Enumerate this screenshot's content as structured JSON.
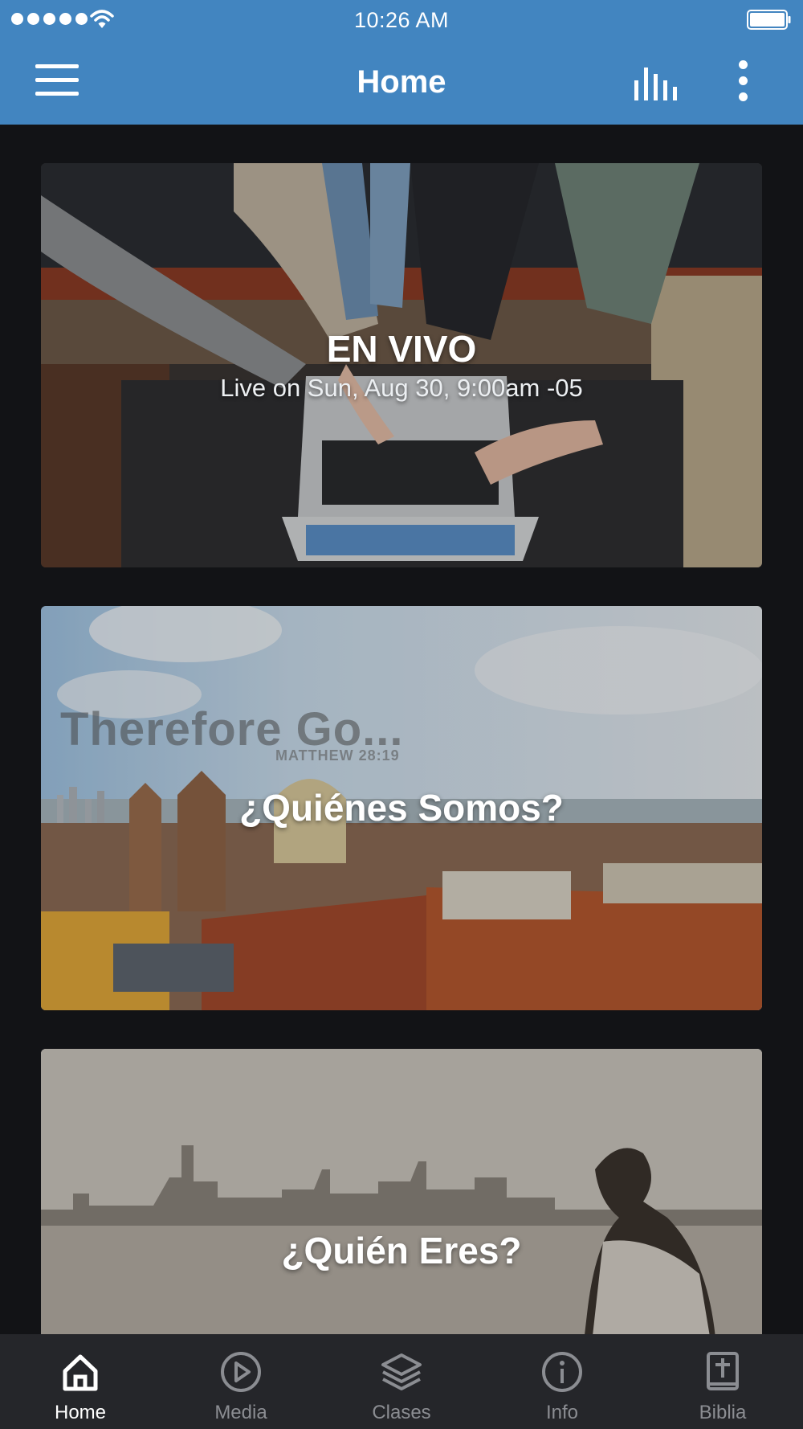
{
  "status_bar": {
    "time": "10:26 AM"
  },
  "app_bar": {
    "title": "Home"
  },
  "cards": [
    {
      "title": "EN VIVO",
      "subtitle": "Live on Sun, Aug 30, 9:00am -05"
    },
    {
      "title": "¿Quiénes Somos?",
      "overlay_text": "Therefore Go...",
      "overlay_reference": "MATTHEW 28:19"
    },
    {
      "title": "¿Quién Eres?"
    }
  ],
  "tabs": [
    {
      "label": "Home",
      "icon": "home-icon",
      "active": true
    },
    {
      "label": "Media",
      "icon": "play-circle-icon",
      "active": false
    },
    {
      "label": "Clases",
      "icon": "layers-icon",
      "active": false
    },
    {
      "label": "Info",
      "icon": "info-icon",
      "active": false
    },
    {
      "label": "Biblia",
      "icon": "bible-icon",
      "active": false
    }
  ],
  "colors": {
    "primary": "#4285c0",
    "background": "#121316",
    "tab_bar": "#25262a",
    "tab_active": "#ffffff",
    "tab_inactive": "#8b8d92"
  }
}
